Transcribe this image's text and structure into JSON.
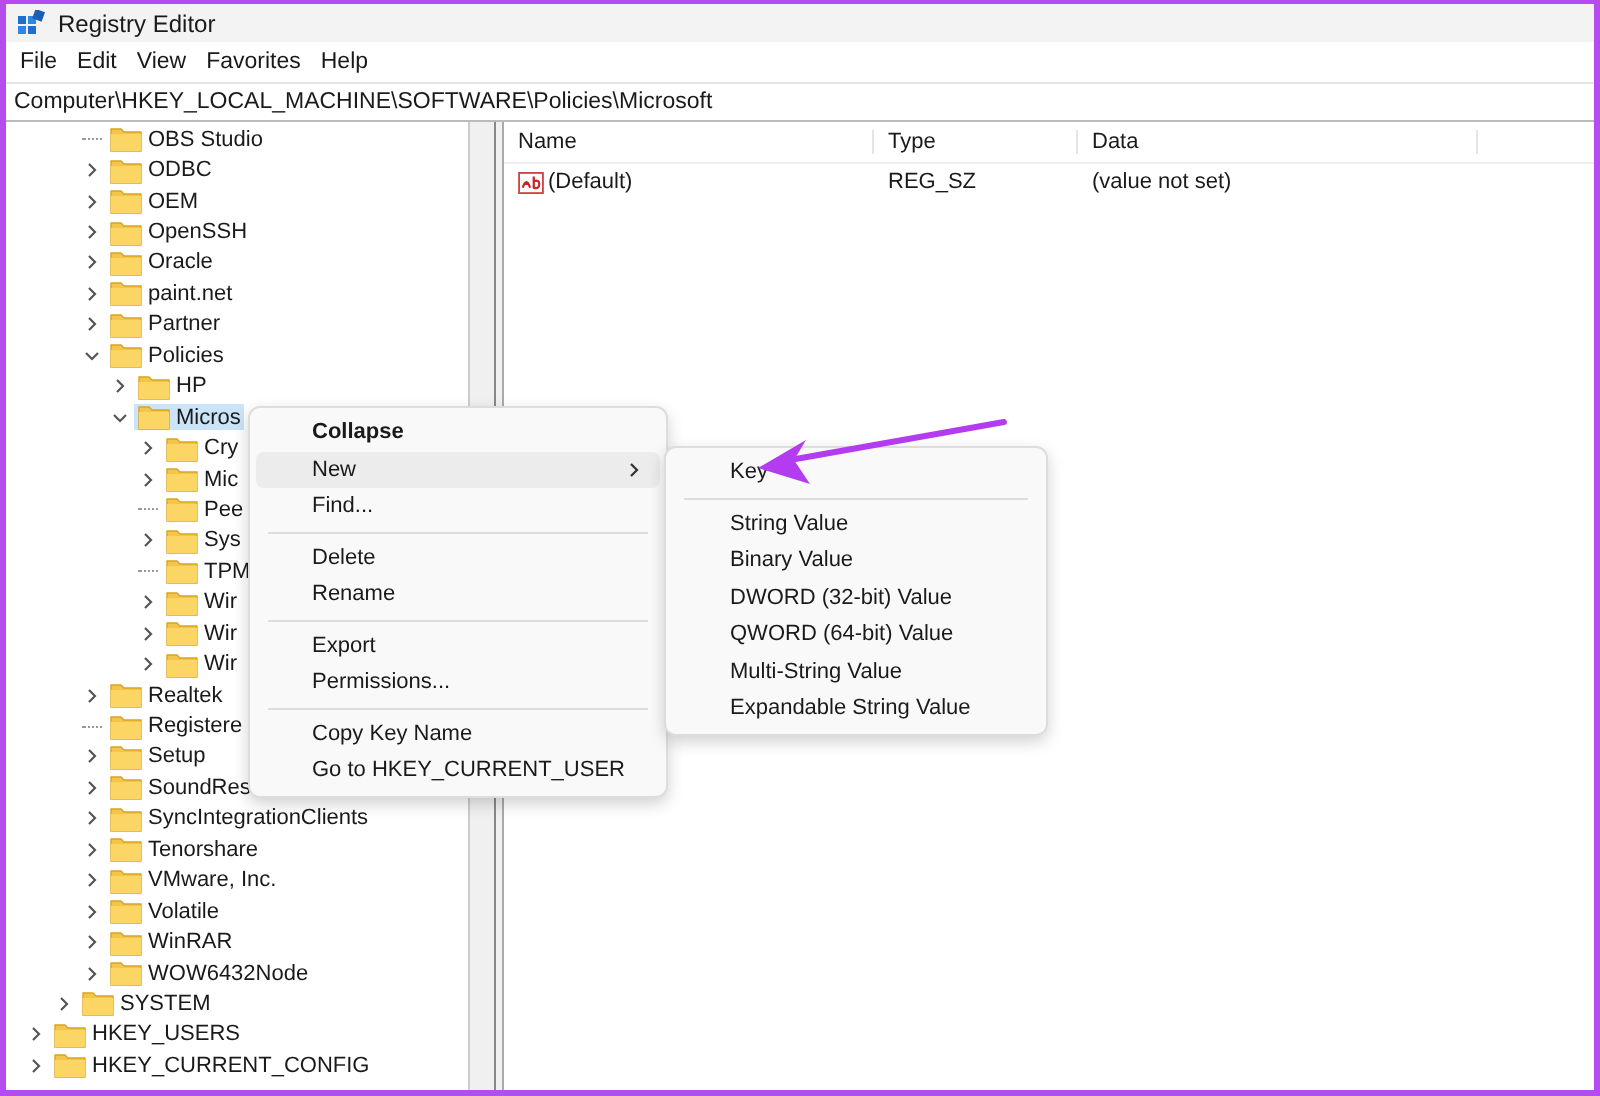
{
  "window": {
    "title": "Registry Editor"
  },
  "menu_bar": [
    "File",
    "Edit",
    "View",
    "Favorites",
    "Help"
  ],
  "address_bar": "Computer\\HKEY_LOCAL_MACHINE\\SOFTWARE\\Policies\\Microsoft",
  "tree": [
    {
      "children": [
        {
          "children": [
            {
              "children": [
                {
                  "label": "OBS Studio",
                  "kind": "leaf"
                },
                {
                  "label": "ODBC",
                  "kind": "branch",
                  "expanded": false
                },
                {
                  "label": "OEM",
                  "kind": "branch",
                  "expanded": false
                },
                {
                  "label": "OpenSSH",
                  "kind": "branch",
                  "expanded": false
                },
                {
                  "label": "Oracle",
                  "kind": "branch",
                  "expanded": false
                },
                {
                  "label": "paint.net",
                  "kind": "branch",
                  "expanded": false
                },
                {
                  "label": "Partner",
                  "kind": "branch",
                  "expanded": false
                },
                {
                  "label": "Policies",
                  "kind": "branch",
                  "expanded": true,
                  "children": [
                    {
                      "label": "HP",
                      "kind": "branch",
                      "expanded": false
                    },
                    {
                      "label": "Micros",
                      "kind": "branch",
                      "expanded": true,
                      "selected": true,
                      "children": [
                        {
                          "label": "Cry",
                          "kind": "branch",
                          "expanded": false
                        },
                        {
                          "label": "Mic",
                          "kind": "branch",
                          "expanded": false
                        },
                        {
                          "label": "Pee",
                          "kind": "leaf"
                        },
                        {
                          "label": "Sys",
                          "kind": "branch",
                          "expanded": false
                        },
                        {
                          "label": "TPM",
                          "kind": "leaf"
                        },
                        {
                          "label": "Wir",
                          "kind": "branch",
                          "expanded": false
                        },
                        {
                          "label": "Wir",
                          "kind": "branch",
                          "expanded": false
                        },
                        {
                          "label": "Wir",
                          "kind": "branch",
                          "expanded": false
                        }
                      ]
                    }
                  ]
                },
                {
                  "label": "Realtek",
                  "kind": "branch",
                  "expanded": false
                },
                {
                  "label": "Registere",
                  "kind": "leaf"
                },
                {
                  "label": "Setup",
                  "kind": "branch",
                  "expanded": false
                },
                {
                  "label": "SoundRes",
                  "kind": "branch",
                  "expanded": false
                },
                {
                  "label": "SyncIntegrationClients",
                  "kind": "branch",
                  "expanded": false
                },
                {
                  "label": "Tenorshare",
                  "kind": "branch",
                  "expanded": false
                },
                {
                  "label": "VMware, Inc.",
                  "kind": "branch",
                  "expanded": false
                },
                {
                  "label": "Volatile",
                  "kind": "branch",
                  "expanded": false
                },
                {
                  "label": "WinRAR",
                  "kind": "branch",
                  "expanded": false
                },
                {
                  "label": "WOW6432Node",
                  "kind": "branch",
                  "expanded": false
                }
              ]
            },
            {
              "label": "SYSTEM",
              "kind": "branch",
              "expanded": false
            }
          ]
        },
        {
          "label": "HKEY_USERS",
          "kind": "branch",
          "expanded": false
        },
        {
          "label": "HKEY_CURRENT_CONFIG",
          "kind": "branch",
          "expanded": false
        }
      ]
    }
  ],
  "values_table": {
    "columns": [
      "Name",
      "Type",
      "Data"
    ],
    "rows": [
      {
        "name": "(Default)",
        "type": "REG_SZ",
        "data": "(value not set)"
      }
    ]
  },
  "context_menu": {
    "groups": [
      [
        {
          "label": "Collapse",
          "default": true,
          "selected": false,
          "has_submenu": false
        },
        {
          "label": "New",
          "default": false,
          "selected": true,
          "has_submenu": true
        },
        {
          "label": "Find...",
          "default": false,
          "selected": false,
          "has_submenu": false
        }
      ],
      [
        {
          "label": "Delete",
          "default": false,
          "selected": false,
          "has_submenu": false
        },
        {
          "label": "Rename",
          "default": false,
          "selected": false,
          "has_submenu": false
        }
      ],
      [
        {
          "label": "Export",
          "default": false,
          "selected": false,
          "has_submenu": false
        },
        {
          "label": "Permissions...",
          "default": false,
          "selected": false,
          "has_submenu": false
        }
      ],
      [
        {
          "label": "Copy Key Name",
          "default": false,
          "selected": false,
          "has_submenu": false
        },
        {
          "label": "Go to HKEY_CURRENT_USER",
          "default": false,
          "selected": false,
          "has_submenu": false
        }
      ]
    ]
  },
  "submenu": {
    "groups": [
      [
        "Key"
      ],
      [
        "String Value",
        "Binary Value",
        "DWORD (32-bit) Value",
        "QWORD (64-bit) Value",
        "Multi-String Value",
        "Expandable String Value"
      ]
    ]
  }
}
